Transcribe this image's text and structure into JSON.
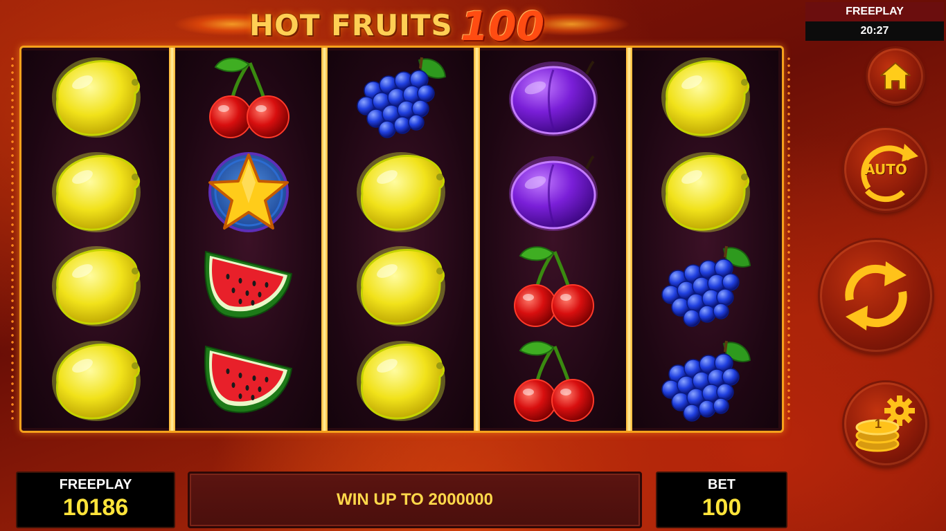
{
  "game": {
    "title_main": "HOT FRUITS",
    "title_number": "100"
  },
  "status": {
    "mode": "FREEPLAY",
    "time": "20:27"
  },
  "buttons": {
    "home_icon": "home-icon",
    "auto_label": "AUTO",
    "spin_icon": "spin-arrows-icon",
    "coin_settings_label": "1"
  },
  "reels": [
    [
      "lemon",
      "lemon",
      "lemon",
      "lemon"
    ],
    [
      "cherry",
      "star",
      "watermelon",
      "watermelon"
    ],
    [
      "grapes",
      "lemon",
      "lemon",
      "lemon"
    ],
    [
      "plum",
      "plum",
      "cherry",
      "cherry"
    ],
    [
      "lemon",
      "lemon",
      "grapes",
      "grapes"
    ]
  ],
  "bottom": {
    "balance_label": "FREEPLAY",
    "balance_value": "10186",
    "message": "WIN UP TO 2000000",
    "bet_label": "BET",
    "bet_value": "100"
  },
  "colors": {
    "frame": "#f5a11c",
    "value_text": "#ffe43a",
    "message_text": "#ffd84a"
  }
}
